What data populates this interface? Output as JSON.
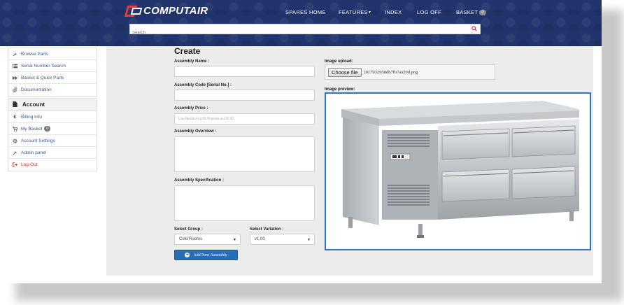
{
  "brand": {
    "name": "COMPUTAIR"
  },
  "nav": {
    "items": [
      {
        "label": "SPARES HOME"
      },
      {
        "label": "FEATURES"
      },
      {
        "label": "INDEX"
      },
      {
        "label": "LOG OFF"
      },
      {
        "label": "BASKET"
      }
    ],
    "features_caret": "▾",
    "basket_count": "0"
  },
  "search": {
    "placeholder": "Search"
  },
  "sidebar": {
    "top_items": [
      {
        "label": "Browse Parts",
        "icon": "wrench-icon"
      },
      {
        "label": "Serial Number Search",
        "icon": "list-icon"
      },
      {
        "label": "Basket & Quick Parts",
        "icon": "fast-forward-icon"
      },
      {
        "label": "Documentation",
        "icon": "paperclip-icon"
      }
    ],
    "account_heading": "Account",
    "account_items": [
      {
        "label": "Billing Info",
        "icon": "pound-icon"
      },
      {
        "label": "My Basket",
        "icon": "cart-icon",
        "badge": "0"
      },
      {
        "label": "Account Settings",
        "icon": "gear-icon"
      },
      {
        "label": "Admin panel",
        "icon": "wrench-icon"
      },
      {
        "label": "Log-Out",
        "icon": "logout-icon"
      }
    ]
  },
  "form": {
    "title": "Create",
    "assembly_name_label": "Assembly Name :",
    "assembly_code_label": "Assembly Code [Serial No.] :",
    "assembly_price_label": "Assembly Price :",
    "assembly_price_placeholder": "Use Decimal e.g 99.99 prints as £99.99",
    "assembly_overview_label": "Assembly Overview :",
    "assembly_spec_label": "Assembly Specification :",
    "select_group_label": "Select Group :",
    "select_group_value": "Cold Rooms",
    "select_variation_label": "Select Variation :",
    "select_variation_value": "v1.00",
    "submit_label": "Add New Assembly",
    "image_upload_label": "Image upload:",
    "choose_file_label": "Choose file",
    "file_name": "2017032958db7fb7aa20d.png",
    "image_preview_label": "Image preview:"
  },
  "colors": {
    "header_bg": "#22346d",
    "accent": "#2a6db7",
    "logout": "#c0392b"
  }
}
